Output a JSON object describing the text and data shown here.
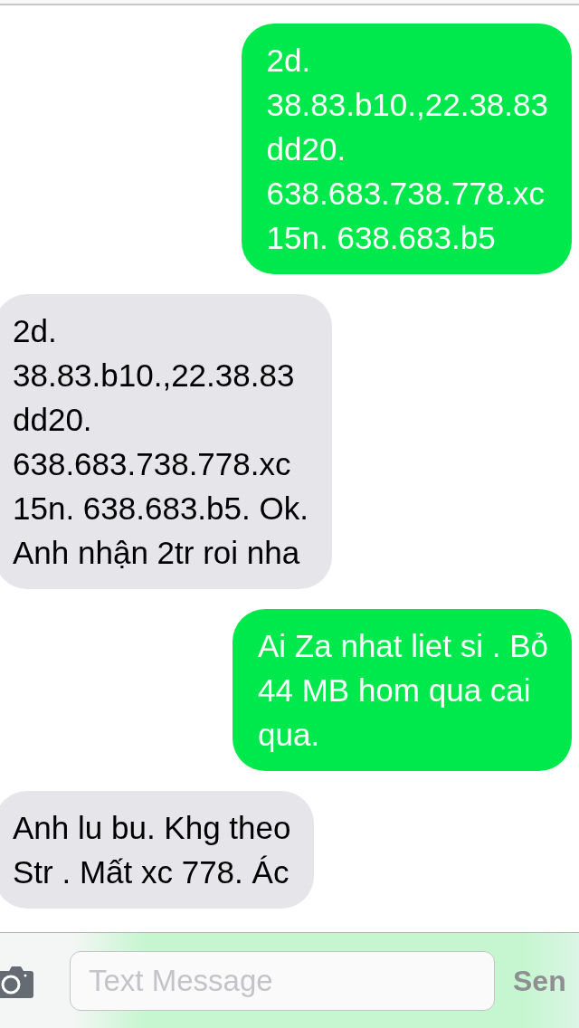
{
  "messages": [
    {
      "kind": "sent",
      "text": "2d.\n38.83.b10.,22.38.83\ndd20.\n638.683.738.778.xc\n15n. 638.683.b5"
    },
    {
      "kind": "received",
      "text": "2d.\n38.83.b10.,22.38.83\ndd20.\n638.683.738.778.xc\n15n. 638.683.b5. Ok.\nAnh nhận 2tr roi nha"
    },
    {
      "kind": "sent",
      "text": "Ai Za nhat liet si . Bỏ\n44 MB hom qua cai\nqua."
    },
    {
      "kind": "received",
      "text": "Anh lu bu. Khg theo\nStr . Mất xc 778. Ác"
    }
  ],
  "composer": {
    "placeholder": "Text Message",
    "send": "Sen"
  }
}
